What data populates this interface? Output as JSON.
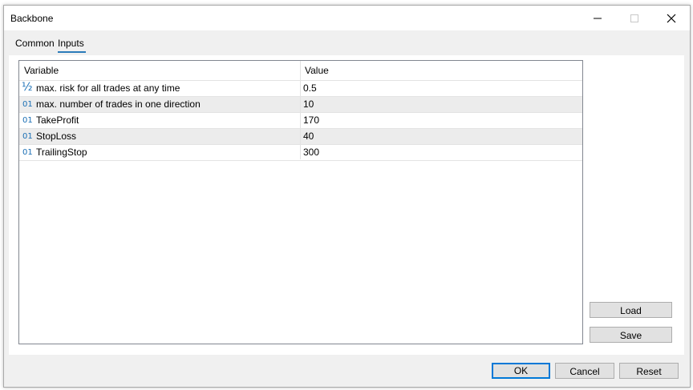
{
  "window": {
    "title": "Backbone"
  },
  "tabs": [
    {
      "label": "Common"
    },
    {
      "label": "Inputs",
      "active": true
    }
  ],
  "grid": {
    "columns": [
      "Variable",
      "Value"
    ],
    "rows": [
      {
        "icon": "½",
        "icon_name": "fraction-icon",
        "variable": "max. risk for all trades at any time",
        "value": "0.5"
      },
      {
        "icon": "01",
        "icon_name": "integer-icon",
        "variable": "max. number of trades in one direction",
        "value": "10"
      },
      {
        "icon": "01",
        "icon_name": "integer-icon",
        "variable": "TakeProfit",
        "value": "170"
      },
      {
        "icon": "01",
        "icon_name": "integer-icon",
        "variable": "StopLoss",
        "value": "40"
      },
      {
        "icon": "01",
        "icon_name": "integer-icon",
        "variable": "TrailingStop",
        "value": "300"
      }
    ]
  },
  "side_buttons": {
    "load": "Load",
    "save": "Save"
  },
  "footer_buttons": {
    "ok": "OK",
    "cancel": "Cancel",
    "reset": "Reset"
  },
  "colors": {
    "accent": "#2b7bb9",
    "icon": "#1a6fb5",
    "focus_border": "#0078d7"
  }
}
